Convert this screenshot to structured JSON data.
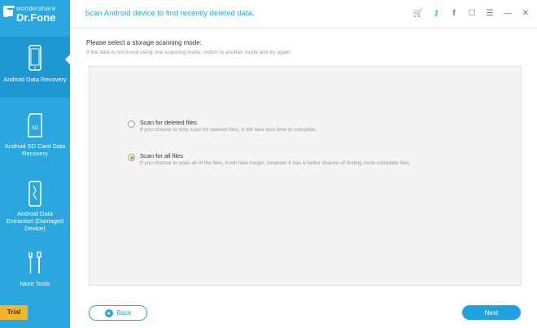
{
  "app": {
    "brand_small": "wondershare",
    "brand_name": "Dr.Fone"
  },
  "header": {
    "title": "Scan Android device to find recently deleted data.",
    "tools": [
      {
        "name": "cart-icon",
        "glyph": "🛒"
      },
      {
        "name": "key-icon",
        "glyph": "⚷"
      },
      {
        "name": "facebook-icon",
        "glyph": "f"
      },
      {
        "name": "feedback-icon",
        "glyph": "☐"
      },
      {
        "name": "menu-icon",
        "glyph": "☰"
      },
      {
        "name": "minimize-icon",
        "glyph": "—"
      },
      {
        "name": "close-icon",
        "glyph": "✕"
      }
    ]
  },
  "sidebar": {
    "items": [
      {
        "label": "Android Data Recovery"
      },
      {
        "label": "Android SD Card Data Recovery"
      },
      {
        "label": "Android Data Extraction (Damaged Device)"
      },
      {
        "label": "More Tools"
      }
    ],
    "trial": "Trial"
  },
  "main": {
    "title": "Please select a storage scanning mode:",
    "subtitle": "If the data is not found using one scanning mode, switch to another mode and try again.",
    "options": [
      {
        "title": "Scan for deleted files",
        "desc": "If you choose to only scan for deleted files, it will take less time to complete.",
        "checked": false
      },
      {
        "title": "Scan for all files",
        "desc": "If you choose to scan all of the files, it will take longer, however it has a better chance of finding more complete files.",
        "checked": true
      }
    ]
  },
  "buttons": {
    "back": "Back",
    "next": "Next"
  },
  "colors": {
    "accent": "#2aa7de",
    "trial": "#f5b52a",
    "radio_checked": "#7cbc3a"
  }
}
